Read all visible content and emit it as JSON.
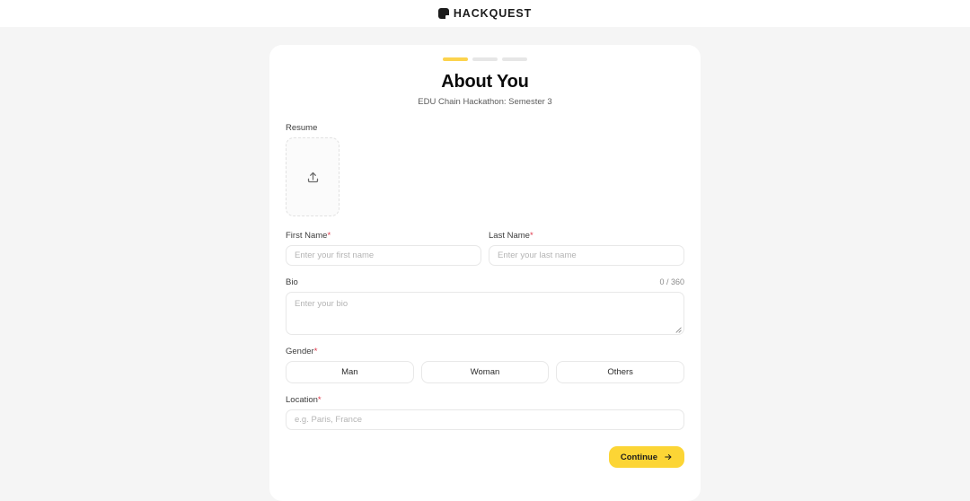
{
  "brand": {
    "name": "HACKQUEST",
    "logo_icon": "hackquest-mark-icon"
  },
  "progress": {
    "steps": [
      {
        "state": "active"
      },
      {
        "state": "inactive"
      },
      {
        "state": "inactive"
      }
    ],
    "active_color": "#fcd34d",
    "inactive_color": "#e6e6e6"
  },
  "form": {
    "title": "About You",
    "subtitle": "EDU Chain Hackathon: Semester 3",
    "resume": {
      "label": "Resume",
      "upload_icon": "upload-icon"
    },
    "first_name": {
      "label": "First Name",
      "required_mark": "*",
      "placeholder": "Enter your first name",
      "value": ""
    },
    "last_name": {
      "label": "Last Name",
      "required_mark": "*",
      "placeholder": "Enter your last name",
      "value": ""
    },
    "bio": {
      "label": "Bio",
      "counter": "0 / 360",
      "placeholder": "Enter your bio",
      "value": ""
    },
    "gender": {
      "label": "Gender",
      "required_mark": "*",
      "options": [
        {
          "label": "Man"
        },
        {
          "label": "Woman"
        },
        {
          "label": "Others"
        }
      ]
    },
    "location": {
      "label": "Location",
      "required_mark": "*",
      "placeholder": "e.g. Paris, France",
      "value": ""
    },
    "continue": {
      "label": "Continue",
      "icon": "arrow-right-icon",
      "color": "#fcd535"
    }
  }
}
